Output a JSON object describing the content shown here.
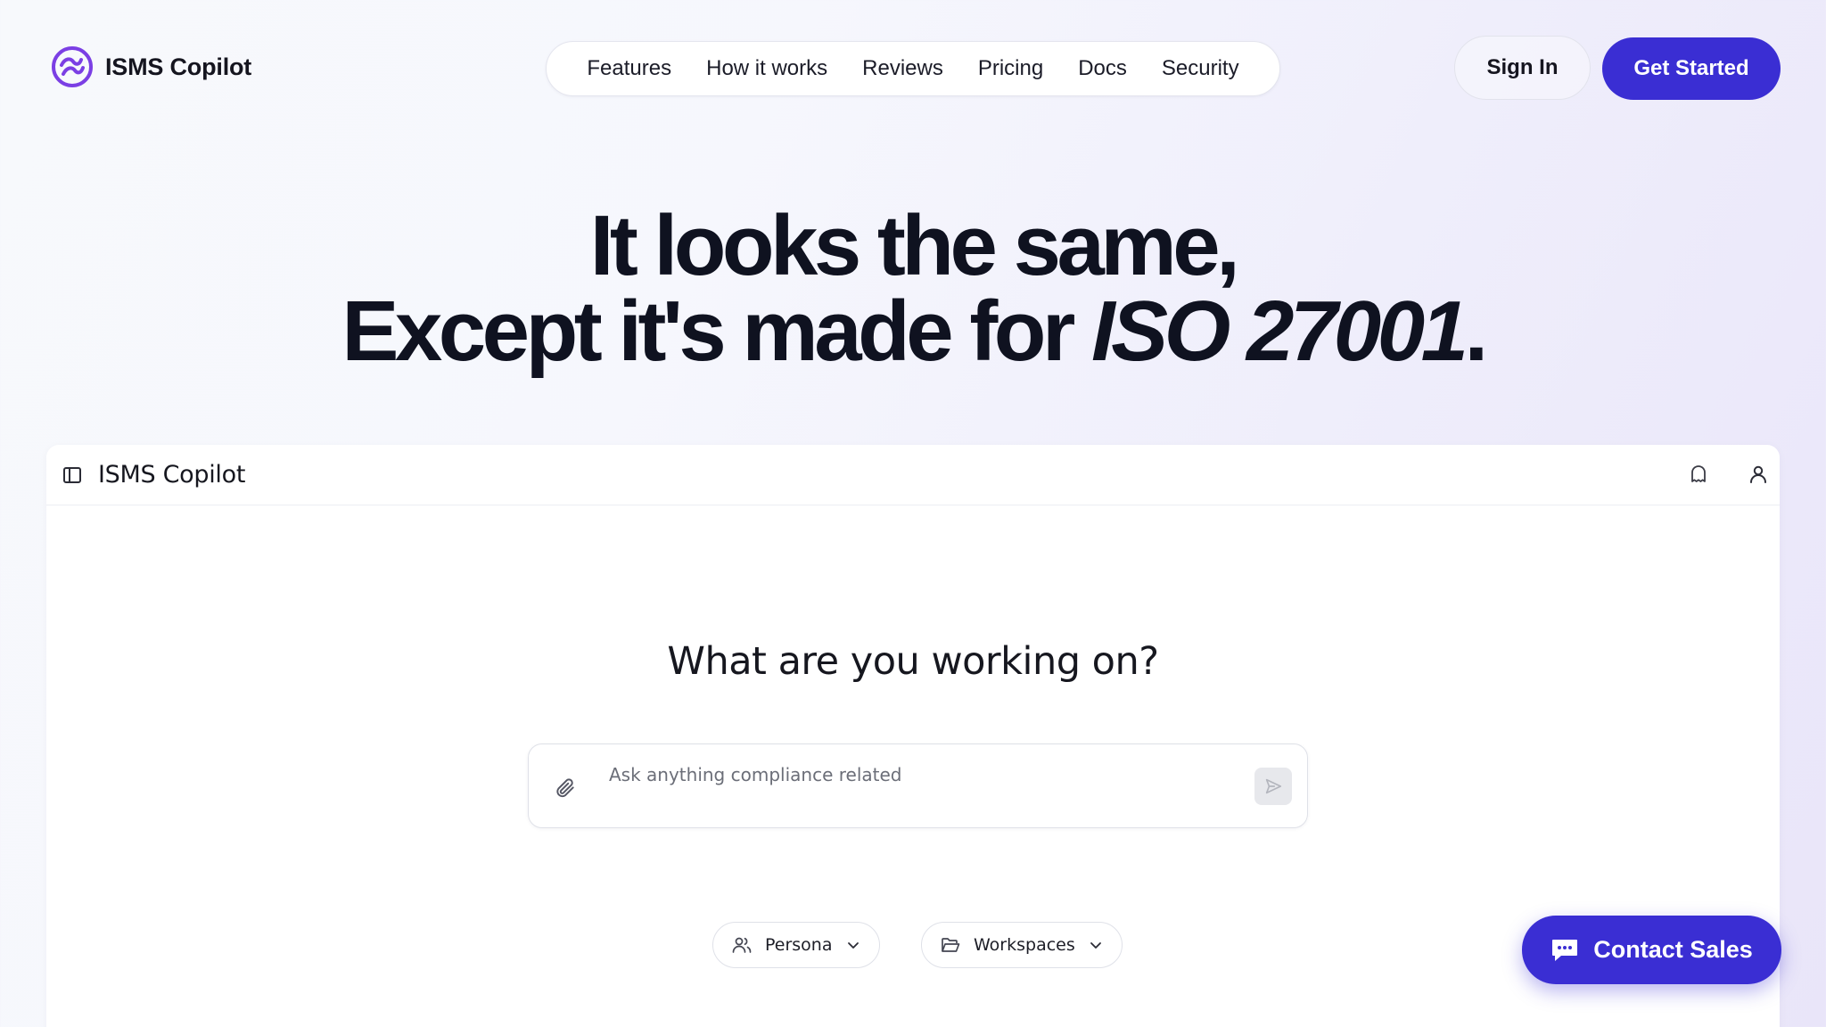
{
  "brand": {
    "name": "ISMS Copilot",
    "logo_icon": "isms-wave-logo-icon",
    "accent": "#7c3aed"
  },
  "nav": {
    "links": [
      "Features",
      "How it works",
      "Reviews",
      "Pricing",
      "Docs",
      "Security"
    ],
    "sign_in": "Sign In",
    "get_started": "Get Started",
    "primary_color": "#3a2ed3"
  },
  "hero": {
    "line1": "It looks the same,",
    "line2_prefix": "Except it's made for ",
    "line2_emphasis": "ISO 27001",
    "line2_suffix": "."
  },
  "app_preview": {
    "title": "ISMS Copilot",
    "icons": [
      "sidebar-toggle-icon",
      "ghost-icon",
      "user-icon"
    ],
    "question": "What are you working on?",
    "input_placeholder": "Ask anything compliance related",
    "persona_label": "Persona",
    "workspaces_label": "Workspaces"
  },
  "contact_sales": {
    "label": "Contact Sales",
    "icon": "chat-bubble-icon"
  }
}
